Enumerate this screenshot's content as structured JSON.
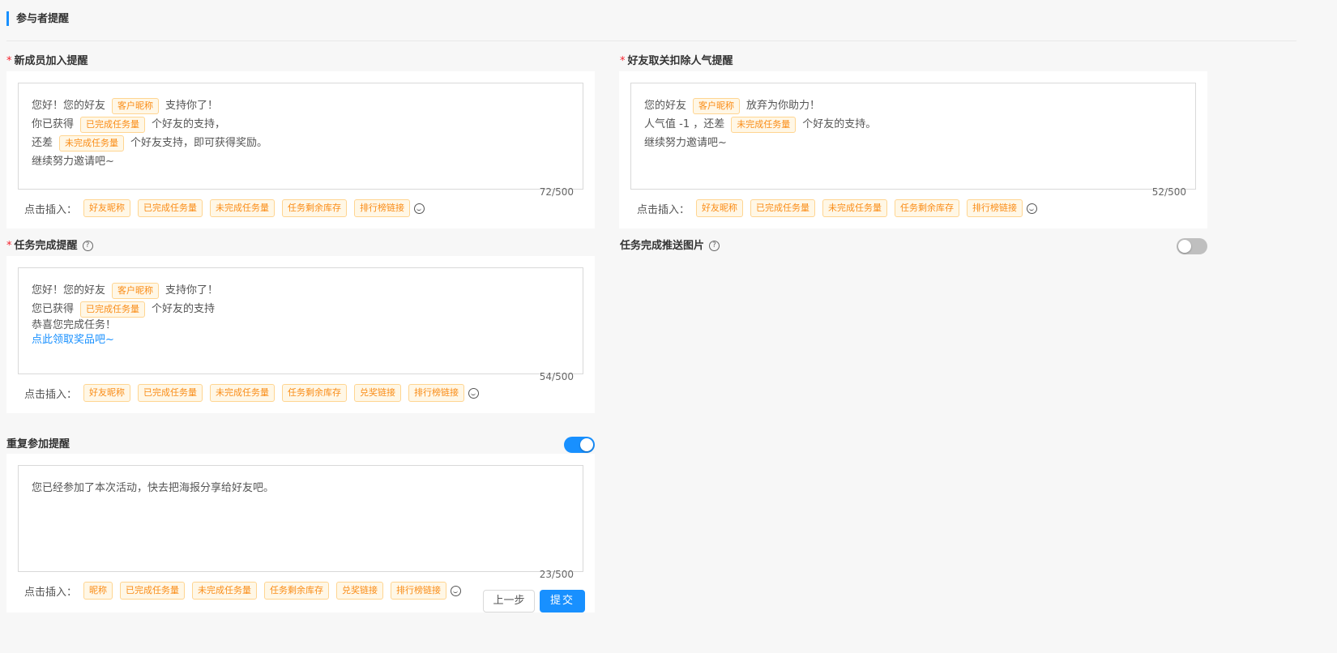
{
  "section": {
    "title": "参与者提醒"
  },
  "insert_label": "点击插入：",
  "new_member": {
    "label": "新成员加入提醒",
    "lines": [
      {
        "before": "您好！您的好友",
        "tag": "客户昵称",
        "after": "支持你了！"
      },
      {
        "before": "你已获得",
        "tag": "已完成任务量",
        "after": "个好友的支持，"
      },
      {
        "before": "还差",
        "tag": "未完成任务量",
        "after": "个好友支持，即可获得奖励。"
      },
      {
        "text": "继续努力邀请吧~"
      }
    ],
    "counter": "72/500",
    "insert_tags": [
      "好友昵称",
      "已完成任务量",
      "未完成任务量",
      "任务剩余库存",
      "排行榜链接"
    ]
  },
  "unfollow": {
    "label": "好友取关扣除人气提醒",
    "lines": [
      {
        "before": "您的好友",
        "tag": "客户昵称",
        "after": "放弃为你助力！"
      },
      {
        "before": "人气值 -1 ，还差",
        "tag": "未完成任务量",
        "after": "个好友的支持。"
      },
      {
        "text": "继续努力邀请吧~"
      }
    ],
    "counter": "52/500",
    "insert_tags": [
      "好友昵称",
      "已完成任务量",
      "未完成任务量",
      "任务剩余库存",
      "排行榜链接"
    ]
  },
  "task_complete": {
    "label": "任务完成提醒",
    "lines": [
      {
        "before": "您好！您的好友",
        "tag": "客户昵称",
        "after": "支持你了！"
      },
      {
        "before": "您已获得",
        "tag": "已完成任务量",
        "after": "个好友的支持"
      },
      {
        "text": "恭喜您完成任务！"
      },
      {
        "link": "点此领取奖品吧~"
      }
    ],
    "counter": "54/500",
    "insert_tags": [
      "好友昵称",
      "已完成任务量",
      "未完成任务量",
      "任务剩余库存",
      "兑奖链接",
      "排行榜链接"
    ]
  },
  "push_image": {
    "label": "任务完成推送图片",
    "enabled": false
  },
  "repeat": {
    "label": "重复参加提醒",
    "enabled": true,
    "lines": [
      {
        "text": "您已经参加了本次活动，快去把海报分享给好友吧。"
      }
    ],
    "counter": "23/500",
    "insert_tags": [
      "昵称",
      "已完成任务量",
      "未完成任务量",
      "任务剩余库存",
      "兑奖链接",
      "排行榜链接"
    ]
  },
  "actions": {
    "prev": "上一步",
    "submit": "提交"
  }
}
